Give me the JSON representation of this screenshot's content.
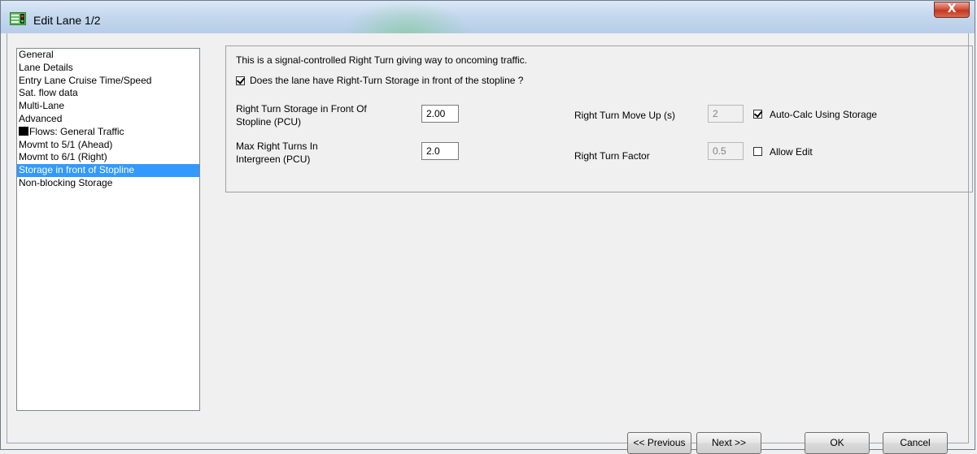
{
  "window": {
    "title": "Edit Lane 1/2",
    "close_label": "X"
  },
  "sidebar": {
    "items": [
      {
        "label": "General"
      },
      {
        "label": "Lane Details"
      },
      {
        "label": "Entry Lane Cruise Time/Speed"
      },
      {
        "label": "Sat. flow data"
      },
      {
        "label": "Multi-Lane"
      },
      {
        "label": "Advanced"
      },
      {
        "label": "Flows: General Traffic",
        "swatch_color": "#000000"
      },
      {
        "label": "Movmt to 5/1 (Ahead)"
      },
      {
        "label": "Movmt to 6/1 (Right)"
      },
      {
        "label": "Storage in front of Stopline",
        "selected": true
      },
      {
        "label": "Non-blocking Storage"
      }
    ],
    "selected_color": "#3399ff"
  },
  "main": {
    "description": "This is a signal-controlled  Right Turn giving way to oncoming traffic.",
    "storage_checkbox": {
      "label": "Does the lane have Right-Turn Storage in front of the stopline ?",
      "checked": true
    },
    "storage_pcu": {
      "label_line1": "Right Turn Storage in Front Of",
      "label_line2": "Stopline (PCU)",
      "value": "2.00"
    },
    "max_turns": {
      "label_line1": "Max Right Turns In",
      "label_line2": "Intergreen (PCU)",
      "value": "2.0"
    },
    "move_up": {
      "label": "Right Turn Move Up (s)",
      "value": "2",
      "disabled": true
    },
    "auto_calc": {
      "label": "Auto-Calc Using Storage",
      "checked": true
    },
    "turn_factor": {
      "label": "Right Turn Factor",
      "value": "0.5",
      "disabled": true
    },
    "allow_edit": {
      "label": "Allow Edit",
      "checked": false
    }
  },
  "footer": {
    "previous_label": "<< Previous",
    "next_label": "Next >>",
    "ok_label": "OK",
    "cancel_label": "Cancel"
  }
}
